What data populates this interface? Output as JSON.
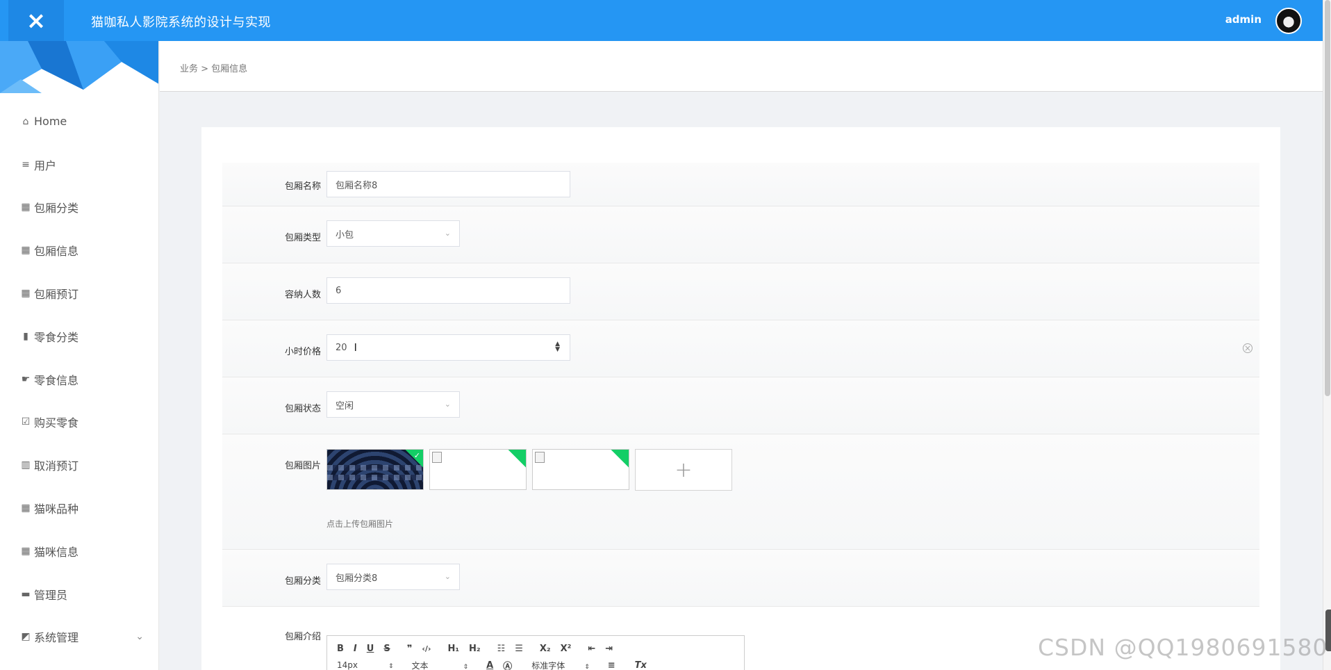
{
  "header": {
    "close_icon": "×",
    "title": "猫咖私人影院系统的设计与实现",
    "user": "admin"
  },
  "breadcrumb": "业务 > 包厢信息",
  "sidebar": {
    "items": [
      {
        "icon": "⌂",
        "icon_name": "home-icon",
        "label": "Home"
      },
      {
        "icon": "≡",
        "icon_name": "list-icon",
        "label": "用户"
      },
      {
        "icon": "▦",
        "icon_name": "grid-icon",
        "label": "包厢分类"
      },
      {
        "icon": "▦",
        "icon_name": "grid-icon",
        "label": "包厢信息"
      },
      {
        "icon": "▦",
        "icon_name": "grid-icon",
        "label": "包厢预订"
      },
      {
        "icon": "▮",
        "icon_name": "book-icon",
        "label": "零食分类"
      },
      {
        "icon": "☛",
        "icon_name": "hand-icon",
        "label": "零食信息"
      },
      {
        "icon": "☑",
        "icon_name": "clipboard-icon",
        "label": "购买零食"
      },
      {
        "icon": "▥",
        "icon_name": "bar-chart-icon",
        "label": "取消预订"
      },
      {
        "icon": "▦",
        "icon_name": "grid-icon",
        "label": "猫咪品种"
      },
      {
        "icon": "▦",
        "icon_name": "grid-icon",
        "label": "猫咪信息"
      },
      {
        "icon": "▬",
        "icon_name": "monitor-icon",
        "label": "管理员"
      },
      {
        "icon": "◩",
        "icon_name": "area-chart-icon",
        "label": "系统管理"
      }
    ],
    "chevron": "⌄"
  },
  "form": {
    "name": {
      "label": "包厢名称",
      "value": "包厢名称8"
    },
    "type": {
      "label": "包厢类型",
      "value": "小包"
    },
    "capacity": {
      "label": "容纳人数",
      "value": "6"
    },
    "hourly_price": {
      "label": "小时价格",
      "value": "20"
    },
    "status": {
      "label": "包厢状态",
      "value": "空闲"
    },
    "images": {
      "label": "包厢图片",
      "tip": "点击上传包厢图片",
      "add": "+"
    },
    "category": {
      "label": "包厢分类",
      "value": "包厢分类8"
    },
    "intro": {
      "label": "包厢介绍"
    }
  },
  "editor": {
    "row1": [
      "B",
      "I",
      "U",
      "S",
      "❞",
      "‹/›",
      "H₁",
      "H₂",
      "☷",
      "☰",
      "X₂",
      "X²",
      "⇤",
      "⇥"
    ],
    "font_size": "14px",
    "format": "文本",
    "font": "标准字体",
    "row2_icons": [
      "A",
      "Ⓐ",
      "≡",
      "Tx"
    ]
  },
  "watermark": "CSDN @QQ1980691580"
}
